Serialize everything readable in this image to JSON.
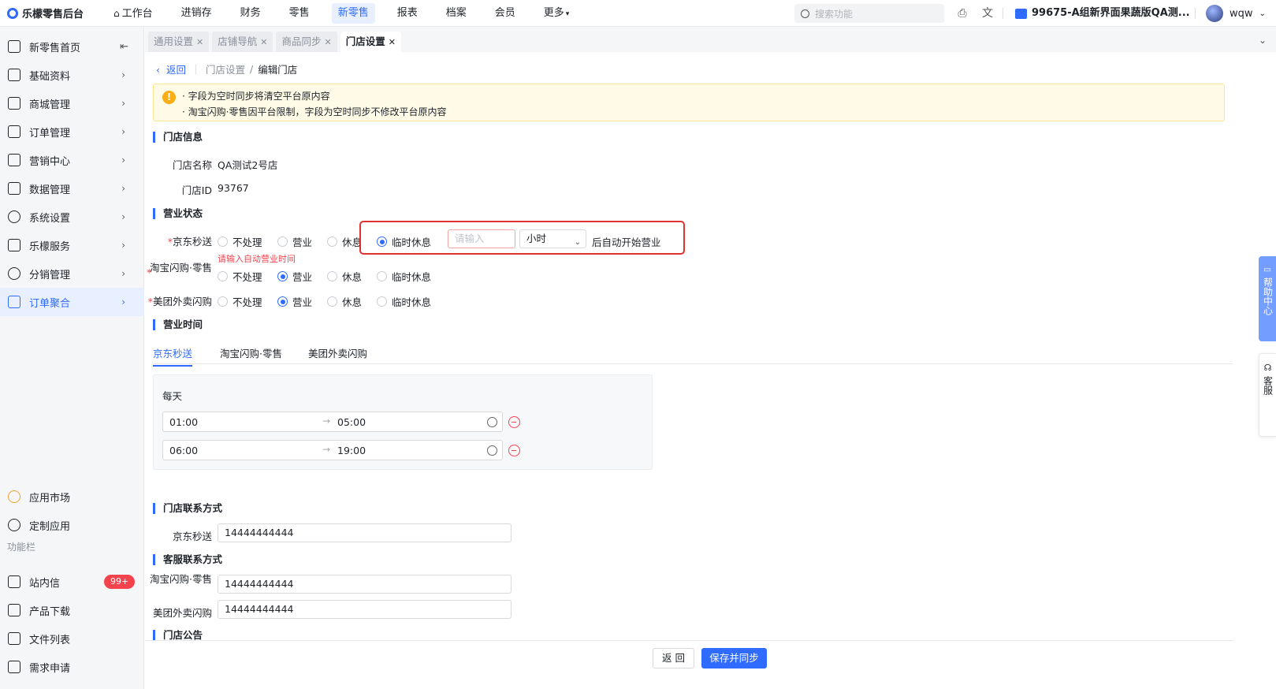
{
  "app": {
    "title": "乐檬零售后台"
  },
  "topnav": {
    "items": [
      "工作台",
      "进销存",
      "财务",
      "零售",
      "新零售",
      "报表",
      "档案",
      "会员",
      "更多"
    ],
    "active": "新零售",
    "search_placeholder": "搜索功能",
    "tenant": "99675-A组新界面果蔬版QA测...",
    "user": "wqw"
  },
  "sidebar": {
    "items": [
      {
        "label": "新零售首页",
        "icon": "home-icon"
      },
      {
        "label": "基础资料",
        "icon": "grid-icon"
      },
      {
        "label": "商城管理",
        "icon": "shop-icon"
      },
      {
        "label": "订单管理",
        "icon": "order-icon"
      },
      {
        "label": "营销中心",
        "icon": "marketing-icon"
      },
      {
        "label": "数据管理",
        "icon": "chart-icon"
      },
      {
        "label": "系统设置",
        "icon": "settings-icon"
      },
      {
        "label": "乐檬服务",
        "icon": "service-icon"
      },
      {
        "label": "分销管理",
        "icon": "distribution-icon"
      },
      {
        "label": "订单聚合",
        "icon": "aggregate-icon"
      }
    ],
    "active": "订单聚合",
    "apps": [
      {
        "label": "应用市场",
        "icon": "app-market-icon"
      },
      {
        "label": "定制应用",
        "icon": "custom-app-icon"
      }
    ],
    "section_label": "功能栏",
    "tools": [
      {
        "label": "站内信",
        "icon": "message-icon",
        "badge": "99+"
      },
      {
        "label": "产品下载",
        "icon": "download-icon"
      },
      {
        "label": "文件列表",
        "icon": "file-icon"
      },
      {
        "label": "需求申请",
        "icon": "request-icon"
      }
    ]
  },
  "tabs": [
    "通用设置",
    "店铺导航",
    "商品同步",
    "门店设置"
  ],
  "active_tab": "门店设置",
  "breadcrumb": {
    "back": "返回",
    "parent": "门店设置",
    "sep": "/",
    "current": "编辑门店"
  },
  "alert": {
    "line1": "· 字段为空时同步将清空平台原内容",
    "line2": "· 淘宝闪购·零售因平台限制，字段为空时同步不修改平台原内容"
  },
  "store_info": {
    "title": "门店信息",
    "name_label": "门店名称",
    "name": "QA测试2号店",
    "id_label": "门店ID",
    "id": "93767"
  },
  "business_status": {
    "title": "营业状态",
    "options": [
      "不处理",
      "营业",
      "休息",
      "临时休息"
    ],
    "rows": [
      {
        "label": "京东秒送",
        "selected": "临时休息"
      },
      {
        "label": "淘宝闪购·零售",
        "selected": "营业"
      },
      {
        "label": "美团外卖闪购",
        "selected": "营业"
      }
    ],
    "temp_input_placeholder": "请输入",
    "temp_unit": "小时",
    "temp_suffix": "后自动开始营业",
    "error": "请输入自动营业时间"
  },
  "business_hours": {
    "title": "营业时间",
    "platform_tabs": [
      "京东秒送",
      "淘宝闪购·零售",
      "美团外卖闪购"
    ],
    "active_platform": "京东秒送",
    "period_label": "每天",
    "ranges": [
      {
        "start": "01:00",
        "end": "05:00"
      },
      {
        "start": "06:00",
        "end": "19:00"
      }
    ]
  },
  "store_contact": {
    "title": "门店联系方式",
    "rows": [
      {
        "label": "京东秒送",
        "value": "14444444444"
      }
    ]
  },
  "cs_contact": {
    "title": "客服联系方式",
    "rows": [
      {
        "label": "淘宝闪购·零售",
        "value": "14444444444"
      },
      {
        "label": "美团外卖闪购",
        "value": "14444444444"
      }
    ]
  },
  "announcement": {
    "title": "门店公告"
  },
  "footer": {
    "back_label": "返 回",
    "save_label": "保存并同步"
  },
  "floating": {
    "help": "帮助中心",
    "cs": "客服"
  },
  "colors": {
    "primary": "#2f6bff",
    "error": "#f5434e",
    "warning_bg": "#fffbe6",
    "highlight": "#e0322f"
  }
}
